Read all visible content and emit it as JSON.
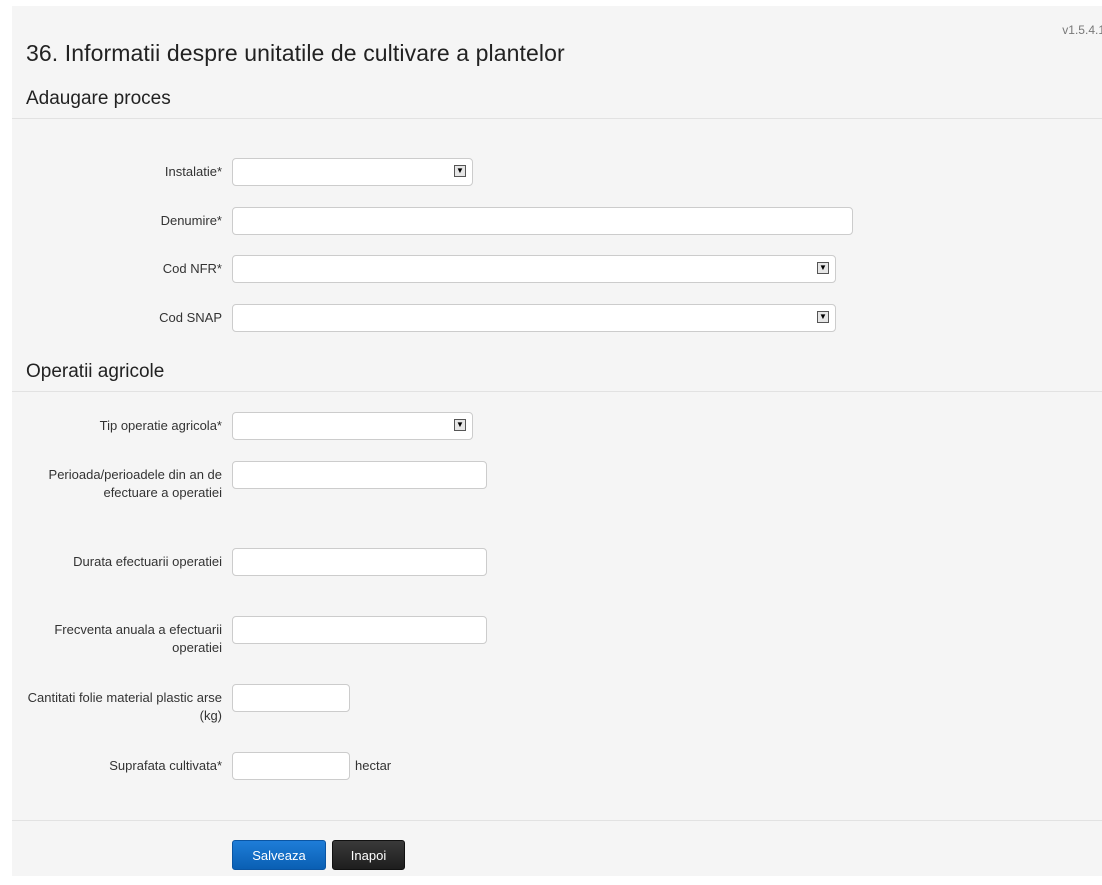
{
  "version": "v1.5.4.1",
  "page_title": "36. Informatii despre unitatile de cultivare a plantelor",
  "sections": {
    "proces": {
      "title": "Adaugare proces"
    },
    "operatii": {
      "title": "Operatii agricole"
    }
  },
  "form": {
    "instalatie": {
      "label": "Instalatie*",
      "value": ""
    },
    "denumire": {
      "label": "Denumire*",
      "value": ""
    },
    "cod_nfr": {
      "label": "Cod NFR*",
      "value": ""
    },
    "cod_snap": {
      "label": "Cod SNAP",
      "value": ""
    },
    "tip_operatie": {
      "label": "Tip operatie agricola*",
      "value": ""
    },
    "perioada": {
      "label": "Perioada/perioadele din an de efectuare a operatiei",
      "value": ""
    },
    "durata": {
      "label": "Durata efectuarii operatiei",
      "value": ""
    },
    "frecventa": {
      "label": "Frecventa anuala a efectuarii operatiei",
      "value": ""
    },
    "cantitati": {
      "label": "Cantitati folie material plastic arse (kg)",
      "value": ""
    },
    "suprafata": {
      "label": "Suprafata cultivata*",
      "value": "",
      "unit": "hectar"
    }
  },
  "buttons": {
    "save": "Salveaza",
    "back": "Inapoi"
  },
  "icons": {
    "select_arrow": "dropdown-arrow-icon"
  }
}
